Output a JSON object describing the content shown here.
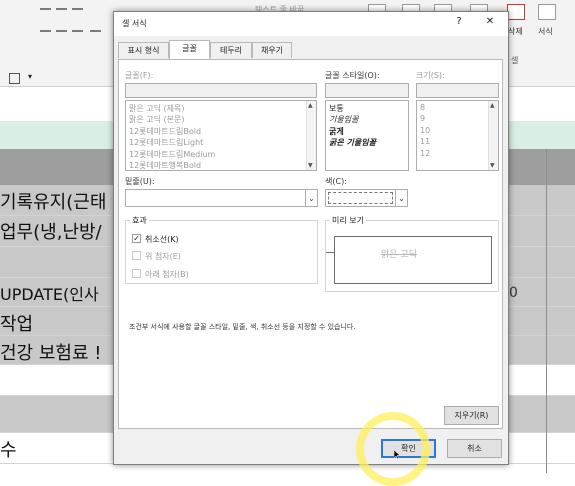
{
  "background": {
    "ribbon": {
      "delete_label": "삭제",
      "format_label": "서식",
      "cells_label": "셀",
      "partial_text": "텍스트 줄 바꿈"
    },
    "rows": [
      {
        "text": "기록유지(근태",
        "shaded": true
      },
      {
        "text": "업무(냉,난방/",
        "shaded": true
      },
      {
        "text": "",
        "shaded": true
      },
      {
        "text": "UPDATE(인사",
        "shaded": true
      },
      {
        "text": "작업",
        "shaded": true
      },
      {
        "text": "건강 보험료 !",
        "shaded": true
      },
      {
        "text": "",
        "shaded": false
      },
      {
        "text": "",
        "shaded": true
      },
      {
        "text": "수",
        "shaded": false
      }
    ],
    "partial_right_text": "0",
    "colors": {
      "header_green": "#d9efe3",
      "band_gray": "#9e9e9e"
    }
  },
  "dialog": {
    "title": "셀 서식",
    "help": "?",
    "close": "✕",
    "tabs": [
      "표시 형식",
      "글꼴",
      "테두리",
      "채우기"
    ],
    "active_tab": "글꼴",
    "font": {
      "label": "글꼴(F):",
      "value": "",
      "items": [
        "맑은 고딕 (제목)",
        "맑은 고딕 (본문)",
        "12롯데마트드림Bold",
        "12롯데마트드림Light",
        "12롯데마트드림Medium",
        "12롯데마트행복Bold"
      ]
    },
    "style": {
      "label": "글꼴 스타일(O):",
      "value": "",
      "items": [
        "보통",
        "기울임꼴",
        "굵게",
        "굵은 기울임꼴"
      ]
    },
    "size": {
      "label": "크기(S):",
      "value": "",
      "items": [
        "8",
        "9",
        "10",
        "11",
        "12"
      ]
    },
    "underline": {
      "label": "밑줄(U):",
      "value": ""
    },
    "color": {
      "label": "색(C):",
      "value": ""
    },
    "effects": {
      "title": "효과",
      "strikethrough": {
        "label": "취소선(K)",
        "checked": true
      },
      "superscript": {
        "label": "위 첨자(E)",
        "checked": false
      },
      "subscript": {
        "label": "아래 첨자(B)",
        "checked": false
      }
    },
    "preview": {
      "title": "미리 보기",
      "sample": "맑은 고딕"
    },
    "description": "조건부 서식에 사용할 글꼴 스타일, 밑줄, 색, 취소선 등을 지정할 수 있습니다.",
    "clear_button": "지우기(R)",
    "ok_button": "확인",
    "cancel_button": "취소"
  }
}
